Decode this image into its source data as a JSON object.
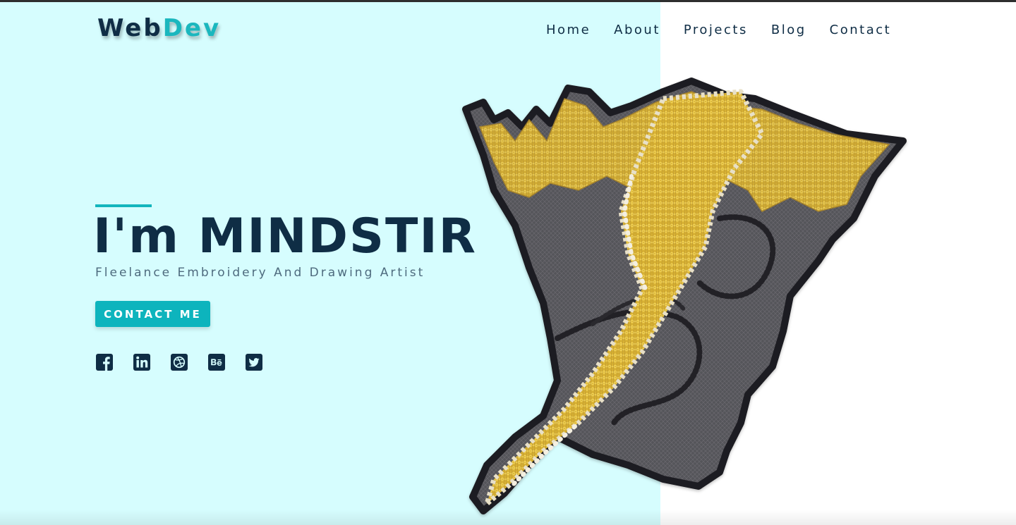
{
  "logo": {
    "part1": "Web",
    "part2": "Dev"
  },
  "nav": {
    "items": [
      {
        "label": "Home"
      },
      {
        "label": "About"
      },
      {
        "label": "Projects"
      },
      {
        "label": "Blog"
      },
      {
        "label": "Contact"
      }
    ]
  },
  "hero": {
    "title": "I'm MINDSTIR",
    "subtitle": "Fleelance Embroidery And Drawing Artist",
    "cta_label": "CONTACT ME"
  },
  "socials": [
    {
      "icon": "facebook-icon"
    },
    {
      "icon": "linkedin-icon"
    },
    {
      "icon": "dribbble-icon"
    },
    {
      "icon": "behance-icon"
    },
    {
      "icon": "twitter-icon"
    }
  ],
  "colors": {
    "navy": "#0f2d45",
    "accent": "#13b5bd",
    "hero_bg": "#d6fdfe",
    "subtitle": "#4e6b7e"
  }
}
